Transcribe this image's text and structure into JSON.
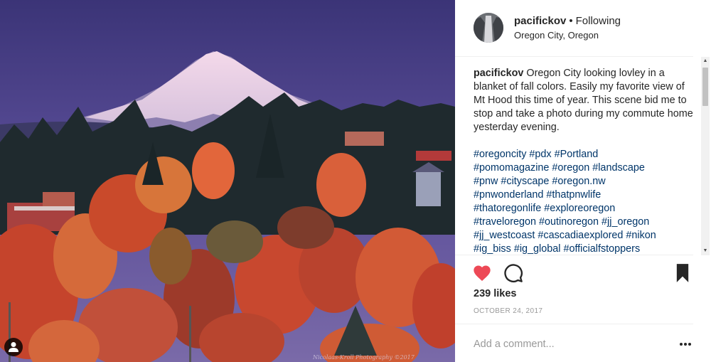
{
  "post": {
    "username": "pacifickov",
    "separator": "•",
    "follow_state": "Following",
    "location": "Oregon City, Oregon",
    "caption_username": "pacifickov",
    "caption_text": "Oregon City looking lovley in a blanket of fall colors. Easily my favorite view of Mt Hood this time of year. This scene bid me to stop and take a photo during my commute home yesterday evening.",
    "hashtag_lines": [
      "#oregoncity #pdx #Portland",
      "#pomomagazine #oregon #landscape",
      "#pnw #cityscape #oregon.nw",
      "#pnwonderland #thatpnwlife",
      "#thatoregonlife #exploreoregon",
      "#traveloregon #outinoregon #jj_oregon",
      "#jj_westcoast #cascadiaexplored #nikon",
      "#ig_biss #ig_global #officialfstoppers"
    ],
    "likes": "239 likes",
    "date": "OCTOBER 24, 2017"
  },
  "photo": {
    "watermark": "Nicolaas-Kroll Photography ©2017"
  },
  "comment": {
    "placeholder": "Add a comment...",
    "more_label": "•••"
  },
  "icons": {
    "like": "heart-filled-icon",
    "comment": "comment-bubble-icon",
    "save": "bookmark-filled-icon",
    "tagged": "user-tag-icon",
    "more": "more-dots-icon"
  },
  "colors": {
    "like_red": "#ed4956",
    "hashtag_blue": "#003569",
    "muted_gray": "#999999",
    "text_dark": "#262626"
  }
}
